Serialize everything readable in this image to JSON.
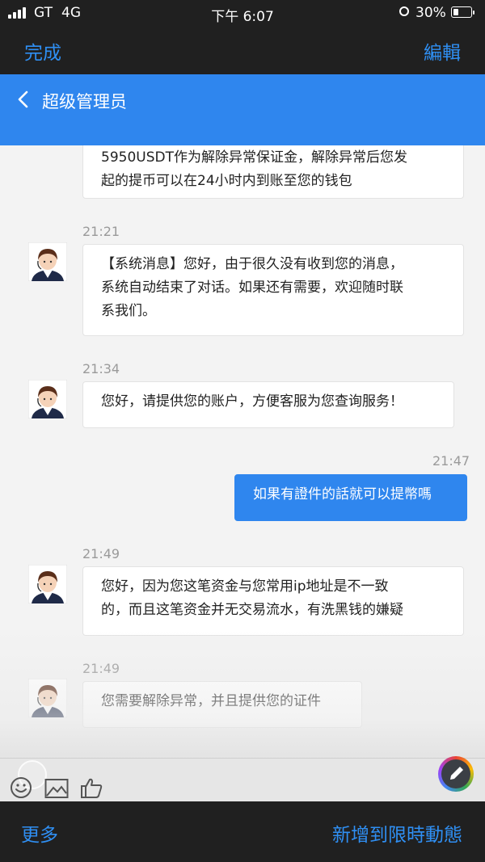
{
  "status_bar": {
    "carrier": "GT",
    "network": "4G",
    "time": "下午 6:07",
    "battery_pct": "30%",
    "battery_level": 0.3
  },
  "viewer_top": {
    "done_label": "完成",
    "edit_label": "編輯"
  },
  "chat_header": {
    "title": "超级管理员"
  },
  "messages": [
    {
      "sender": "agent",
      "time": "",
      "lines": [
        "5950USDT作为解除异常保证金，解除异常后您发",
        "起的提币可以在24小时内到账至您的钱包"
      ]
    },
    {
      "sender": "agent",
      "time": "21:21",
      "lines": [
        "【系统消息】您好，由于很久没有收到您的消息，",
        "系统自动结束了对话。如果还有需要，欢迎随时联",
        "系我们。"
      ]
    },
    {
      "sender": "agent",
      "time": "21:34",
      "lines": [
        "您好，请提供您的账户，方便客服为您查询服务！"
      ]
    },
    {
      "sender": "user",
      "time": "21:47",
      "lines": [
        "如果有證件的話就可以提幣嗎"
      ]
    },
    {
      "sender": "agent",
      "time": "21:49",
      "lines": [
        "您好，因为您这笔资金与您常用ip地址是不一致",
        "的，而且这笔资金并无交易流水，有洗黑钱的嫌疑"
      ]
    },
    {
      "sender": "agent",
      "time": "21:49",
      "lines": [
        "您需要解除异常，并且提供您的证件"
      ]
    }
  ],
  "toolbar": {
    "icons": [
      "smiley-icon",
      "image-icon",
      "thumbs-up-icon",
      "markup-edit-icon"
    ]
  },
  "viewer_bottom": {
    "more_label": "更多",
    "add_label": "新增到限時動態"
  },
  "colors": {
    "accent": "#2f86ee",
    "link": "#2f8ff3",
    "bar": "#202020",
    "background": "#f3f3f3"
  }
}
